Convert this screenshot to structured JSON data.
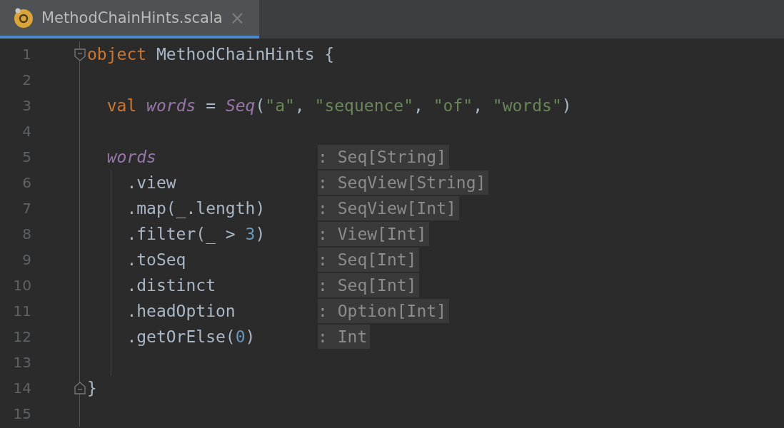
{
  "tabs": [
    {
      "title": "MethodChainHints.scala",
      "selected": true,
      "close": "×"
    }
  ],
  "lines": [
    {
      "number": "1",
      "fold_start": true,
      "tokens": [
        {
          "kind": "keyword",
          "text": "object"
        },
        {
          "kind": "plain",
          "text": " MethodChainHints {"
        }
      ]
    },
    {
      "number": "2"
    },
    {
      "number": "3",
      "tokens": [
        {
          "kind": "keyword",
          "text": "  val "
        },
        {
          "kind": "field",
          "text": "words"
        },
        {
          "kind": "plain",
          "text": " = "
        },
        {
          "kind": "call",
          "text": "Seq"
        },
        {
          "kind": "plain",
          "text": "("
        },
        {
          "kind": "string",
          "text": "\"a\""
        },
        {
          "kind": "plain",
          "text": ", "
        },
        {
          "kind": "string",
          "text": "\"sequence\""
        },
        {
          "kind": "plain",
          "text": ", "
        },
        {
          "kind": "string",
          "text": "\"of\""
        },
        {
          "kind": "plain",
          "text": ", "
        },
        {
          "kind": "string",
          "text": "\"words\""
        },
        {
          "kind": "plain",
          "text": ")"
        }
      ]
    },
    {
      "number": "4"
    },
    {
      "number": "5",
      "tokens": [
        {
          "kind": "field",
          "text": "  words"
        }
      ],
      "hint": ": Seq[String]"
    },
    {
      "number": "6",
      "guide": true,
      "tokens": [
        {
          "kind": "plain",
          "text": "    .view"
        }
      ],
      "hint": ": SeqView[String]"
    },
    {
      "number": "7",
      "guide": true,
      "tokens": [
        {
          "kind": "plain",
          "text": "    .map(_.length)"
        }
      ],
      "hint": ": SeqView[Int]"
    },
    {
      "number": "8",
      "guide": true,
      "tokens": [
        {
          "kind": "plain",
          "text": "    .filter(_ > "
        },
        {
          "kind": "number",
          "text": "3"
        },
        {
          "kind": "plain",
          "text": ")"
        }
      ],
      "hint": ": View[Int]"
    },
    {
      "number": "9",
      "guide": true,
      "tokens": [
        {
          "kind": "plain",
          "text": "    .toSeq"
        }
      ],
      "hint": ": Seq[Int]"
    },
    {
      "number": "10",
      "guide": true,
      "tokens": [
        {
          "kind": "plain",
          "text": "    .distinct"
        }
      ],
      "hint": ": Seq[Int]"
    },
    {
      "number": "11",
      "guide": true,
      "tokens": [
        {
          "kind": "plain",
          "text": "    .headOption"
        }
      ],
      "hint": ": Option[Int]"
    },
    {
      "number": "12",
      "guide": true,
      "tokens": [
        {
          "kind": "plain",
          "text": "    .getOrElse("
        },
        {
          "kind": "number",
          "text": "0"
        },
        {
          "kind": "plain",
          "text": ")"
        }
      ],
      "hint": ": Int"
    },
    {
      "number": "13",
      "guide": true
    },
    {
      "number": "14",
      "fold_end": true,
      "tokens": [
        {
          "kind": "plain",
          "text": "}"
        }
      ]
    },
    {
      "number": "15"
    }
  ]
}
